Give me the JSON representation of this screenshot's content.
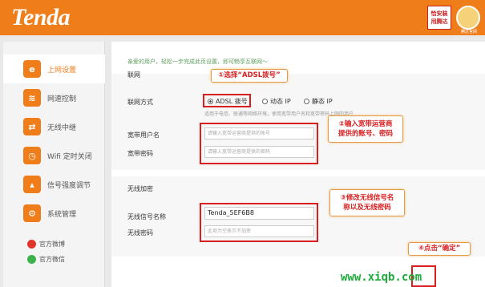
{
  "header": {
    "brand": "Tenda",
    "badge_line1": "恰安装",
    "badge_line2": "用腾达",
    "badge2_caption": "腾达官网"
  },
  "sidebar": {
    "items": [
      {
        "label": "上网设置",
        "icon": "internet-e-icon",
        "active": true
      },
      {
        "label": "网速控制",
        "icon": "speed-wave-icon",
        "active": false
      },
      {
        "label": "无线中继",
        "icon": "wireless-relay-icon",
        "active": false
      },
      {
        "label": "Wifi 定时关闭",
        "icon": "wifi-timer-icon",
        "active": false
      },
      {
        "label": "信号强度调节",
        "icon": "signal-strength-icon",
        "active": false
      },
      {
        "label": "系统管理",
        "icon": "gear-icon",
        "active": false
      }
    ],
    "social": [
      {
        "label": "官方微博",
        "icon": "weibo-icon"
      },
      {
        "label": "官方微信",
        "icon": "wechat-icon"
      }
    ]
  },
  "main": {
    "greeting": "亲爱的用户，轻松一步完成此页设置，即可畅享互联网～",
    "wan_title": "联网",
    "connection_label": "联网方式",
    "options": [
      "ADSL 拨号",
      "动态 IP",
      "静态 IP"
    ],
    "hint": "适用于电信、联通等网络环境，使用宽带用户名和宽带密码上网的用户",
    "username_label": "宽带用户名",
    "username_placeholder": "请输入宽带运营商提供的账号",
    "password_label": "宽带密码",
    "password_placeholder": "请输入宽带运营商提供的密码",
    "wireless_title": "无线加密",
    "ssid_label": "无线信号名称",
    "ssid_value": "Tenda_5EF6B8",
    "wifi_pwd_label": "无线密码",
    "wifi_pwd_placeholder": "此项为空表示不加密"
  },
  "annotations": {
    "step1": "①选择“ADSL拨号”",
    "step2_line1": "②输入宽带运营商",
    "step2_line2": "提供的账号、密码",
    "step3_line1": "③修改无线信号名",
    "step3_line2": "称以及无线密码",
    "step4": "④点击“确定”"
  },
  "watermark": "www.xiqb.com",
  "colors": {
    "brand_orange": "#ee7d1a",
    "annotation_red": "#d81e1e",
    "greeting_green": "#5fa05f",
    "watermark_green": "#1faa3c"
  }
}
